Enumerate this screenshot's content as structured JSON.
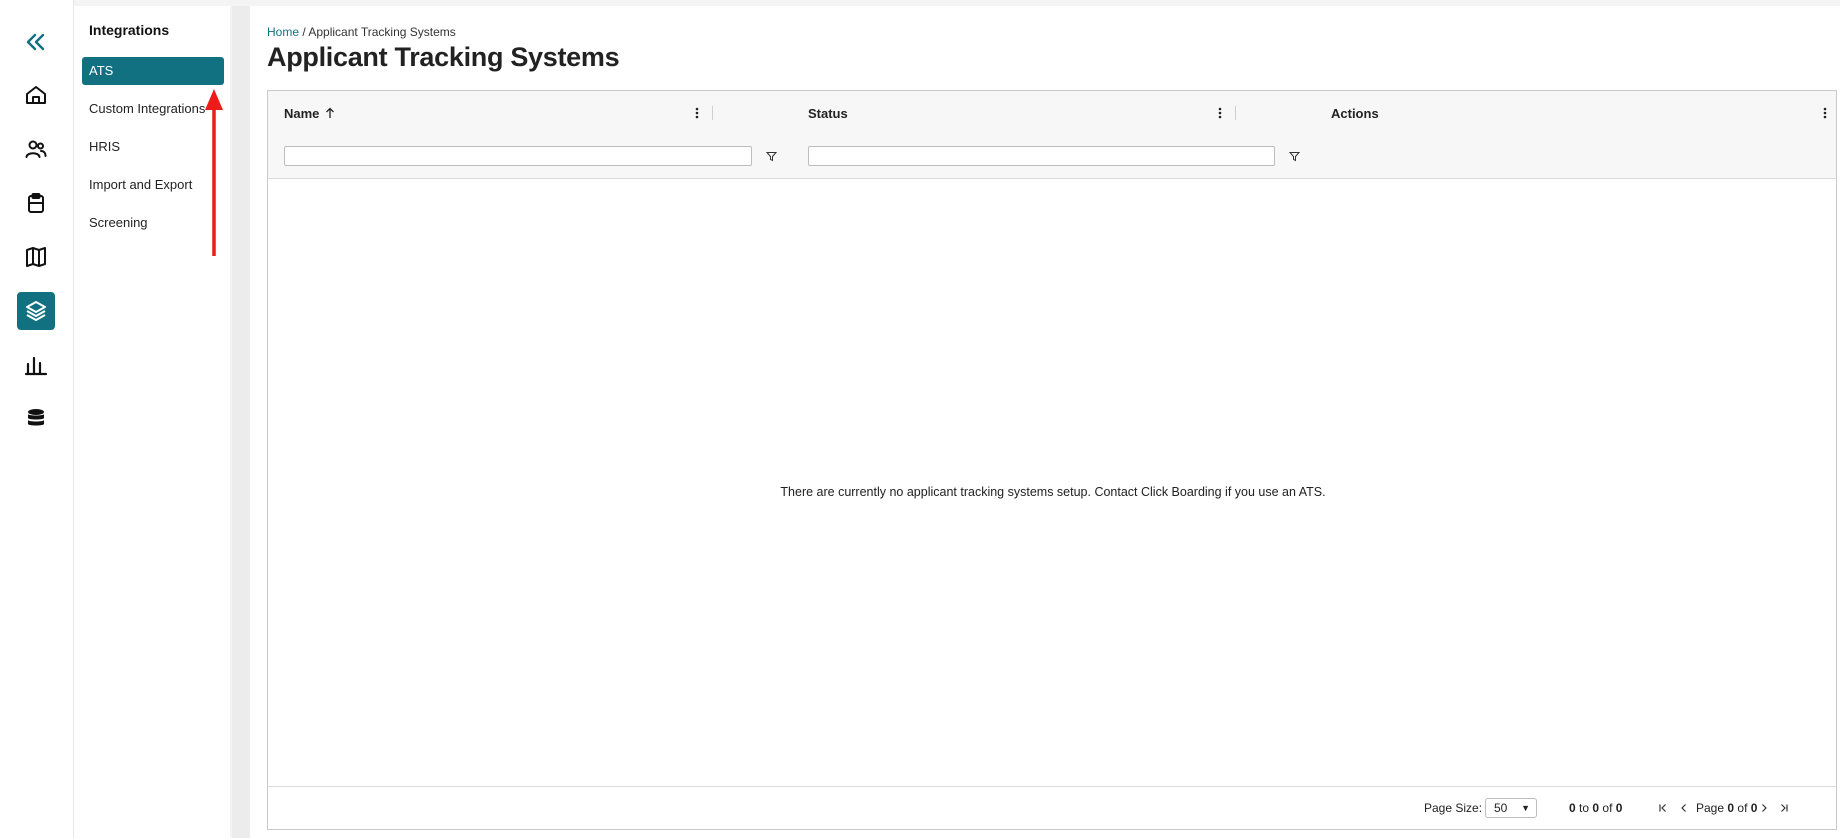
{
  "rail": {
    "items": [
      {
        "name": "collapse",
        "icon": "double-chevron-left-icon"
      },
      {
        "name": "home",
        "icon": "home-icon"
      },
      {
        "name": "people",
        "icon": "users-icon"
      },
      {
        "name": "clipboard",
        "icon": "clipboard-icon"
      },
      {
        "name": "map",
        "icon": "map-icon"
      },
      {
        "name": "integrations",
        "icon": "layers-icon",
        "active": true
      },
      {
        "name": "reports",
        "icon": "bar-chart-icon"
      },
      {
        "name": "data",
        "icon": "database-icon"
      }
    ],
    "accent": "#127180"
  },
  "subnav": {
    "title": "Integrations",
    "items": [
      {
        "label": "ATS",
        "active": true
      },
      {
        "label": "Custom Integrations"
      },
      {
        "label": "HRIS"
      },
      {
        "label": "Import and Export"
      },
      {
        "label": "Screening"
      }
    ]
  },
  "breadcrumb": {
    "home": "Home",
    "separator": "/",
    "current": "Applicant Tracking Systems"
  },
  "page": {
    "title": "Applicant Tracking Systems"
  },
  "grid": {
    "columns": [
      {
        "label": "Name",
        "sort": "ascending",
        "sort_icon": "arrow-up-icon"
      },
      {
        "label": "Status"
      },
      {
        "label": "Actions"
      }
    ],
    "filters": [
      {
        "value": "",
        "placeholder": ""
      },
      {
        "value": "",
        "placeholder": ""
      }
    ],
    "empty_message": "There are currently no applicant tracking systems setup. Contact Click Boarding if you use an ATS."
  },
  "pager": {
    "page_size_label": "Page Size:",
    "page_size": "50",
    "range_from": "0",
    "range_to_word": "to",
    "range_to": "0",
    "range_of_word": "of",
    "total": "0",
    "page_word": "Page",
    "page_current": "0",
    "page_of_word": "of",
    "page_total": "0"
  }
}
